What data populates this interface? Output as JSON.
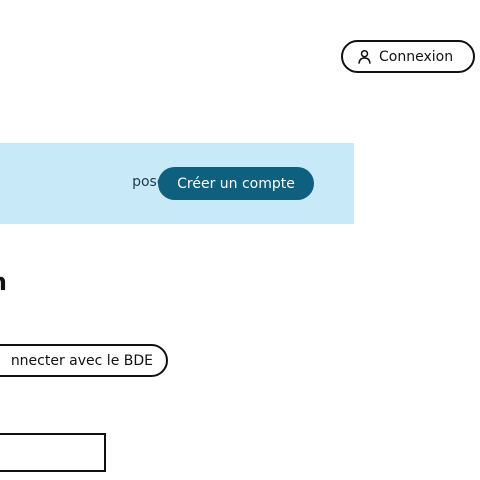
{
  "header": {
    "login_label": "Connexion",
    "login_icon": "user-icon"
  },
  "banner": {
    "text": "poser une annonce.",
    "create_account_label": "Créer un compte",
    "background_color": "#c8e9f8",
    "button_color": "#0f5f7e"
  },
  "main": {
    "heading": "n",
    "bde_login_label": "nnecter avec le BDE",
    "input_value": ""
  }
}
